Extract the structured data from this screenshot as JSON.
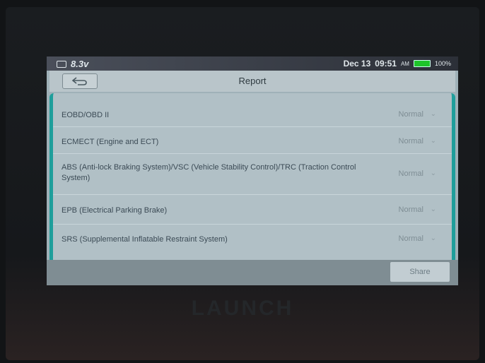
{
  "device": {
    "brand": "LAUNCH"
  },
  "statusbar": {
    "voltage": "8.3v",
    "date": "Dec 13",
    "time": "09:51",
    "ampm": "AM",
    "battery_percent": "100%",
    "icons": [
      "car-icon",
      "battery-icon"
    ],
    "battery_color": "#1ec42a"
  },
  "titlebar": {
    "title": "Report",
    "back_icon": "back-arrow-icon"
  },
  "systems": [
    {
      "label": "EOBD/OBD II",
      "status": "Normal"
    },
    {
      "label": "ECMECT (Engine and ECT)",
      "status": "Normal"
    },
    {
      "label": "ABS (Anti-lock Braking System)/VSC (Vehicle Stability Control)/TRC (Traction Control System)",
      "status": "Normal"
    },
    {
      "label": "EPB (Electrical Parking Brake)",
      "status": "Normal"
    },
    {
      "label": "SRS (Supplemental Inflatable Restraint System)",
      "status": "Normal"
    }
  ],
  "bottombar": {
    "share_label": "Share"
  },
  "colors": {
    "accent": "#1f9e9b",
    "status_text": "#7e8d94"
  }
}
